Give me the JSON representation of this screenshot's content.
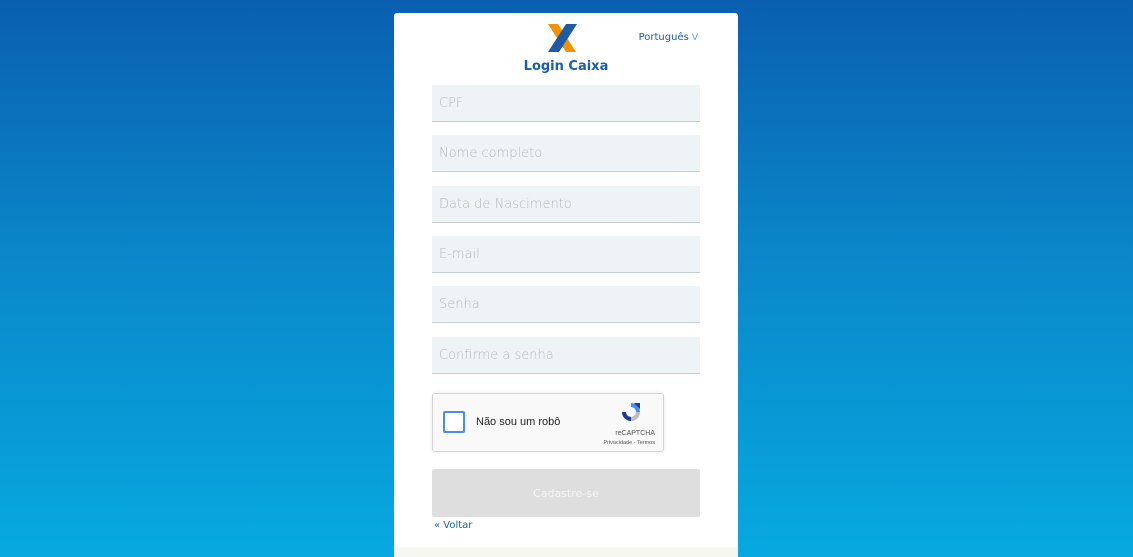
{
  "header": {
    "brand_title": "Login Caixa",
    "language_label": "Português",
    "language_chevron": "V"
  },
  "form": {
    "fields": [
      {
        "placeholder": "CPF",
        "value": ""
      },
      {
        "placeholder": "Nome completo",
        "value": ""
      },
      {
        "placeholder": "Data de Nascimento",
        "value": ""
      },
      {
        "placeholder": "E-mail",
        "value": ""
      },
      {
        "placeholder": "Senha",
        "value": ""
      },
      {
        "placeholder": "Confirme a senha",
        "value": ""
      }
    ],
    "captcha": {
      "label": "Não sou um robô",
      "brand": "reCAPTCHA",
      "links": "Privacidade - Termos",
      "checked": false
    },
    "submit_label": "Cadastre-se",
    "back_label": "« Voltar"
  },
  "colors": {
    "brand_blue": "#1a5da8",
    "logo_orange": "#f39200",
    "logo_blue": "#1f5aa6",
    "bg_top": "#0a5fb0",
    "bg_bottom": "#07a9e0"
  },
  "icons": {
    "logo": "caixa-x-logo",
    "captcha": "recaptcha-logo-icon"
  }
}
